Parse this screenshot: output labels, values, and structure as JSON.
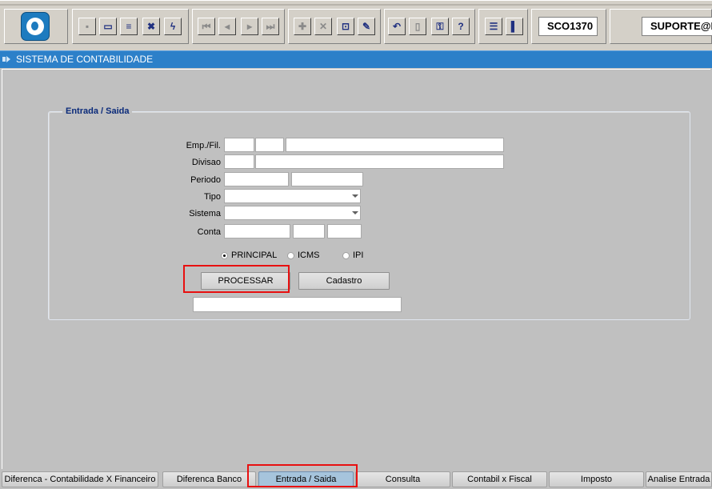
{
  "toolbar": {
    "logo_icon": "d-logo-icon",
    "buttons": [
      {
        "icon": "save-icon",
        "glyph": "▪"
      },
      {
        "icon": "window-icon",
        "glyph": "▭"
      },
      {
        "icon": "print-icon",
        "glyph": "≡"
      },
      {
        "icon": "exit-icon",
        "glyph": "✖"
      },
      {
        "icon": "wand-icon",
        "glyph": "ϟ"
      },
      {
        "icon": "first-record-icon",
        "glyph": "⏮"
      },
      {
        "icon": "previous-record-icon",
        "glyph": "◂"
      },
      {
        "icon": "next-record-icon",
        "glyph": "▸"
      },
      {
        "icon": "last-record-icon",
        "glyph": "⏭"
      },
      {
        "icon": "insert-record-icon",
        "glyph": "✚"
      },
      {
        "icon": "delete-record-icon",
        "glyph": "✕"
      },
      {
        "icon": "query-icon",
        "glyph": "⊡"
      },
      {
        "icon": "edit-icon",
        "glyph": "✎"
      },
      {
        "icon": "undo-icon",
        "glyph": "↶"
      },
      {
        "icon": "clipboard-icon",
        "glyph": "▯"
      },
      {
        "icon": "key-icon",
        "glyph": "⚿"
      },
      {
        "icon": "help-icon",
        "glyph": "?"
      },
      {
        "icon": "menu-icon",
        "glyph": "☰"
      },
      {
        "icon": "exit-door-icon",
        "glyph": "▌"
      }
    ],
    "form_code": "SCO1370",
    "user": "SUPORTE@H"
  },
  "title_bar": {
    "title": "SISTEMA DE CONTABILIDADE"
  },
  "form": {
    "section_title": "Entrada / Saida",
    "labels": {
      "emp_fil": "Emp./Fil.",
      "divisao": "Divisao",
      "periodo": "Periodo",
      "tipo": "Tipo",
      "sistema": "Sistema",
      "conta": "Conta"
    },
    "radios": [
      {
        "label": "PRINCIPAL",
        "checked": true
      },
      {
        "label": "ICMS",
        "checked": false
      },
      {
        "label": "IPI",
        "checked": false
      }
    ],
    "buttons": {
      "processar": "PROCESSAR",
      "cadastro": "Cadastro"
    }
  },
  "tabs": [
    {
      "label": "Diferenca - Contabilidade X Financeiro",
      "active": false
    },
    {
      "label": "Diferenca Banco",
      "active": false
    },
    {
      "label": "Entrada / Saida",
      "active": true
    },
    {
      "label": "Consulta",
      "active": false
    },
    {
      "label": "Contabil x Fiscal",
      "active": false
    },
    {
      "label": "Imposto",
      "active": false
    },
    {
      "label": "Analise Entrada",
      "active": false
    }
  ],
  "colors": {
    "title_bar": "#2c80c9",
    "highlight": "#e81010",
    "active_tab": "#a6c4dc"
  }
}
